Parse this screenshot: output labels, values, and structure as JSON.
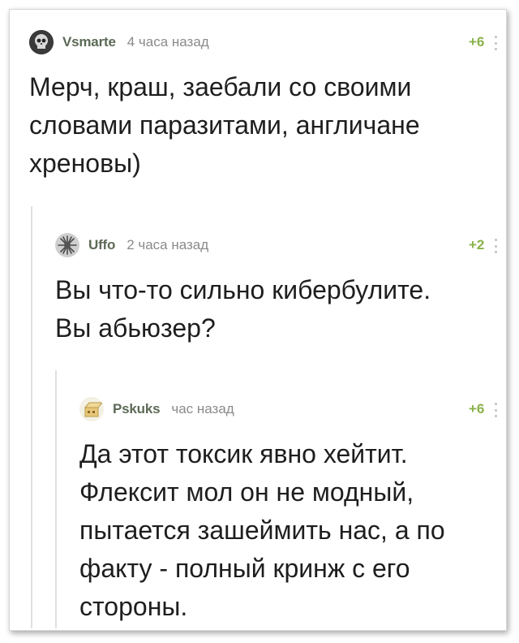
{
  "comments": [
    {
      "author": "Vsmarte",
      "time": "4 часа назад",
      "rating": "+6",
      "avatar_icon": "skull-avatar-icon",
      "text": "Мерч, краш, заебали со своими\nсловами паразитами, англичане\nхреновы)"
    },
    {
      "author": "Uffo",
      "time": "2 часа назад",
      "rating": "+2",
      "avatar_icon": "spiky-avatar-icon",
      "text": "Вы что-то сильно кибербулите.\nВы абьюзер?"
    },
    {
      "author": "Pskuks",
      "time": "час назад",
      "rating": "+6",
      "avatar_icon": "box-avatar-icon",
      "text": "Да этот токсик явно хейтит.\nФлексит мол он не модный,\nпытается зашеймить нас, а по\nфакту - полный кринж с его\nстороны."
    }
  ],
  "colors": {
    "author": "#5c6a56",
    "time": "#8a8a8a",
    "rating": "#8ab24a",
    "text": "#1e1e1e",
    "thread_line": "#e0e0e0"
  }
}
